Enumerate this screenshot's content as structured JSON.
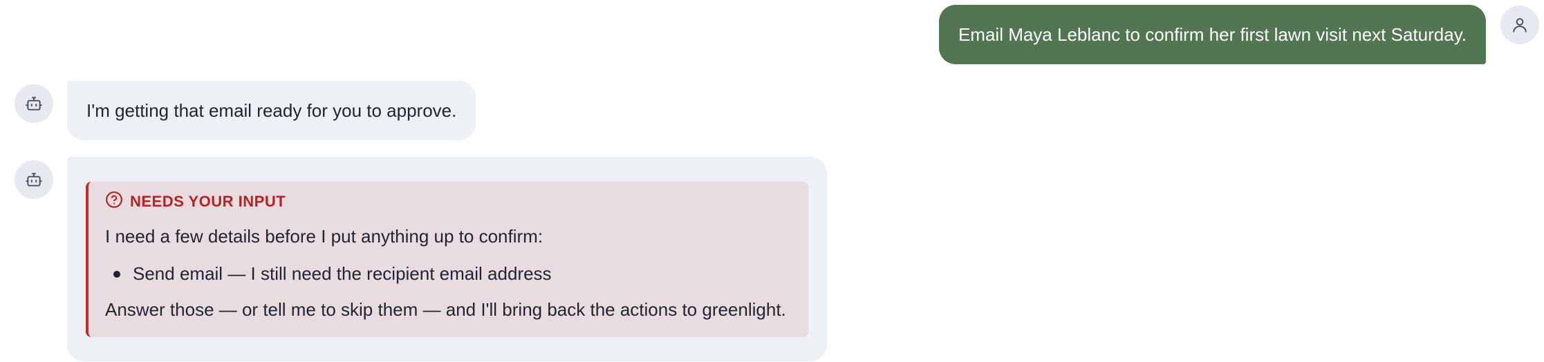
{
  "messages": {
    "user": {
      "text": "Email Maya Leblanc to confirm her first lawn visit next Saturday.",
      "avatar_icon": "user-icon"
    },
    "assistant_1": {
      "text": "I'm getting that email ready for you to approve.",
      "avatar_icon": "robot-icon"
    },
    "assistant_2": {
      "avatar_icon": "robot-icon",
      "callout": {
        "icon": "question-circle-icon",
        "title": "NEEDS YOUR INPUT",
        "intro": "I need a few details before I put anything up to confirm:",
        "items": [
          "Send email — I still need the recipient email address"
        ],
        "outro": "Answer those — or tell me to skip them — and I'll bring back the actions to greenlight."
      }
    }
  },
  "colors": {
    "user_bubble": "#527552",
    "assistant_bubble": "#edf0f5",
    "callout_bg": "#e9dce1",
    "callout_accent": "#c22b2b",
    "callout_title": "#b42323"
  }
}
